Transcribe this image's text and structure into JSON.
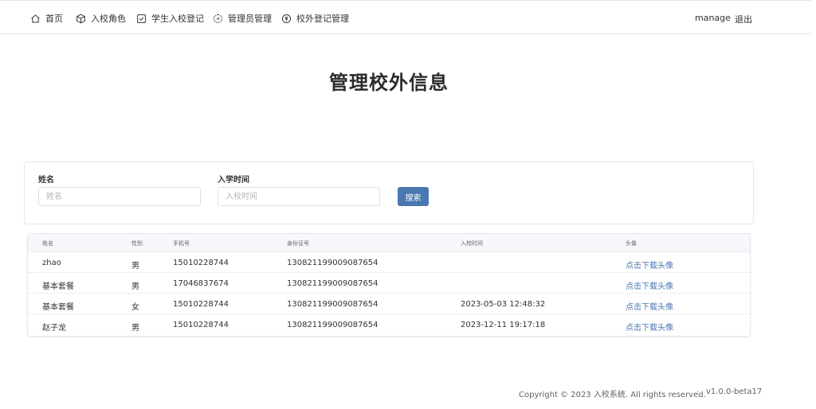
{
  "nav": {
    "items": [
      {
        "label": "首页",
        "icon": "home-icon"
      },
      {
        "label": "入校角色",
        "icon": "cube-icon"
      },
      {
        "label": "学生入校登记",
        "icon": "checkbox-icon"
      },
      {
        "label": "管理员管理",
        "icon": "hexagon-icon"
      },
      {
        "label": "校外登记管理",
        "icon": "coin-icon"
      }
    ],
    "user": "manage",
    "logout": "退出"
  },
  "page": {
    "title": "管理校外信息"
  },
  "search": {
    "name_label": "姓名",
    "name_placeholder": "姓名",
    "name_value": "",
    "date_label": "入学时间",
    "date_placeholder": "入校时间",
    "date_value": "",
    "button": "搜索",
    "button_color": "#4a78b0"
  },
  "table": {
    "headers": [
      "姓名",
      "性别",
      "手机号",
      "身份证号",
      "入校时间",
      "头像"
    ],
    "rows": [
      {
        "name": "zhao",
        "gender": "男",
        "phone": "15010228744",
        "id_number": "130821199009087654",
        "time": "",
        "avatar": "点击下载头像"
      },
      {
        "name": "基本套餐",
        "gender": "男",
        "phone": "17046837674",
        "id_number": "130821199009087654",
        "time": "",
        "avatar": "点击下载头像"
      },
      {
        "name": "基本套餐",
        "gender": "女",
        "phone": "15010228744",
        "id_number": "130821199009087654",
        "time": "2023-05-03 12:48:32",
        "avatar": "点击下载头像"
      },
      {
        "name": "赵子龙",
        "gender": "男",
        "phone": "15010228744",
        "id_number": "130821199009087654",
        "time": "2023-12-11 19:17:18",
        "avatar": "点击下载头像"
      }
    ]
  },
  "footer": {
    "copyright": "Copyright © 2023 入校系统. All rights reserved.",
    "separator": "·",
    "version": "v1.0.0-beta17"
  },
  "colors": {
    "link": "#4a78b0",
    "border": "#e4e7ed"
  }
}
